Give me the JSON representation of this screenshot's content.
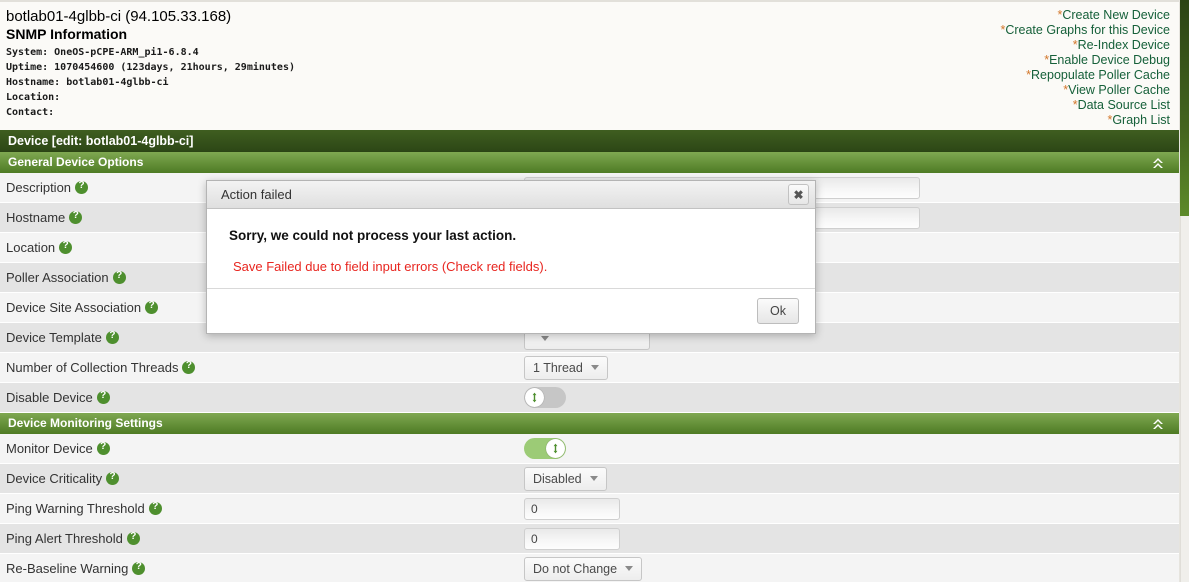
{
  "header": {
    "device_title": "botlab01-4glbb-ci (94.105.33.168)",
    "snmp_heading": "SNMP Information",
    "snmp": [
      "System: OneOS-pCPE-ARM_pi1-6.8.4",
      "Uptime: 1070454600 (123days, 21hours, 29minutes)",
      "Hostname: botlab01-4glbb-ci",
      "Location:",
      "Contact:"
    ]
  },
  "actions": {
    "marker": "*",
    "items": [
      {
        "label": "Create New Device"
      },
      {
        "label": "Create Graphs for this Device"
      },
      {
        "label": "Re-Index Device"
      },
      {
        "label": "Enable Device Debug"
      },
      {
        "label": "Repopulate Poller Cache"
      },
      {
        "label": "View Poller Cache"
      },
      {
        "label": "Data Source List"
      },
      {
        "label": "Graph List"
      }
    ]
  },
  "panel": {
    "title": "Device [edit: botlab01-4glbb-ci]",
    "section_general": "General Device Options",
    "section_monitoring": "Device Monitoring Settings",
    "collapse_icon": "chevron-double-up-icon",
    "rows": [
      {
        "label": "Description",
        "control": "text",
        "value": "",
        "width": "wide"
      },
      {
        "label": "Hostname",
        "control": "text",
        "value": "",
        "width": "wide"
      },
      {
        "label": "Location",
        "control": "text",
        "value": "",
        "width": "mid"
      },
      {
        "label": "Poller Association",
        "control": "select",
        "value": ""
      },
      {
        "label": "Device Site Association",
        "control": "select",
        "value": ""
      },
      {
        "label": "Device Template",
        "control": "select",
        "value": ""
      },
      {
        "label": "Number of Collection Threads",
        "control": "select",
        "value": "1 Thread"
      },
      {
        "label": "Disable Device",
        "control": "toggle",
        "value": "off"
      },
      {
        "label": "Monitor Device",
        "control": "toggle",
        "value": "on"
      },
      {
        "label": "Device Criticality",
        "control": "select",
        "value": "Disabled"
      },
      {
        "label": "Ping Warning Threshold",
        "control": "text",
        "value": "0",
        "width": "small"
      },
      {
        "label": "Ping Alert Threshold",
        "control": "text",
        "value": "0",
        "width": "small"
      },
      {
        "label": "Re-Baseline Warning",
        "control": "select",
        "value": "Do not Change"
      }
    ]
  },
  "dialog": {
    "title": "Action failed",
    "close_icon": "close-icon",
    "message": "Sorry, we could not process your last action.",
    "error": "Save Failed due to field input errors (Check red fields).",
    "ok_label": "Ok"
  },
  "colors": {
    "bar_dark": "#2d4716",
    "bar_light": "#4e7b24",
    "link": "#16603a",
    "asterisk": "#d2762a",
    "error": "#e8251f",
    "toggle_on": "#9ccb76",
    "toggle_off": "#c6c6c6",
    "help_icon": "#4e8f2e"
  }
}
